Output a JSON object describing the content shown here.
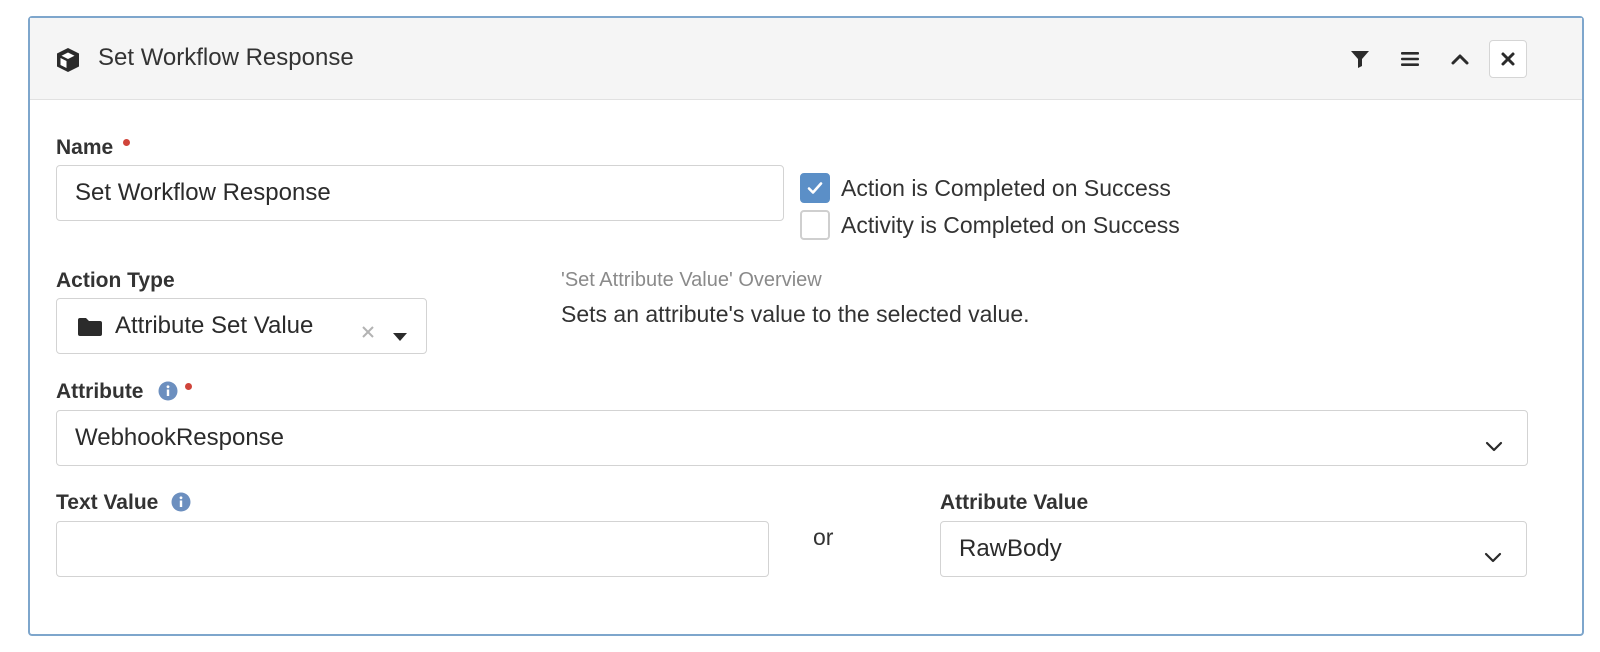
{
  "header": {
    "icon": "cube-icon",
    "title": "Set Workflow Response",
    "buttons": [
      "filter-icon",
      "menu-icon",
      "chevron-up-icon",
      "close-icon"
    ]
  },
  "name_field": {
    "label": "Name",
    "required": true,
    "value": "Set Workflow Response"
  },
  "completion": {
    "action_completed": {
      "label": "Action is Completed on Success",
      "checked": true
    },
    "activity_completed": {
      "label": "Activity is Completed on Success",
      "checked": false
    }
  },
  "action_type": {
    "label": "Action Type",
    "icon": "folder-icon",
    "value": "Attribute Set Value"
  },
  "overview": {
    "title": "'Set Attribute Value' Overview",
    "description": "Sets an attribute's value to the selected value."
  },
  "attribute": {
    "label": "Attribute",
    "required": true,
    "value": "WebhookResponse"
  },
  "text_value": {
    "label": "Text Value",
    "value": ""
  },
  "or_text": "or",
  "attribute_value": {
    "label": "Attribute Value",
    "value": "RawBody"
  },
  "colors": {
    "accent": "#5b8fc7",
    "panel_border": "#7ea6cc",
    "required": "#d0443a",
    "info": "#6c8fbf",
    "header_bg": "#f5f5f5"
  }
}
